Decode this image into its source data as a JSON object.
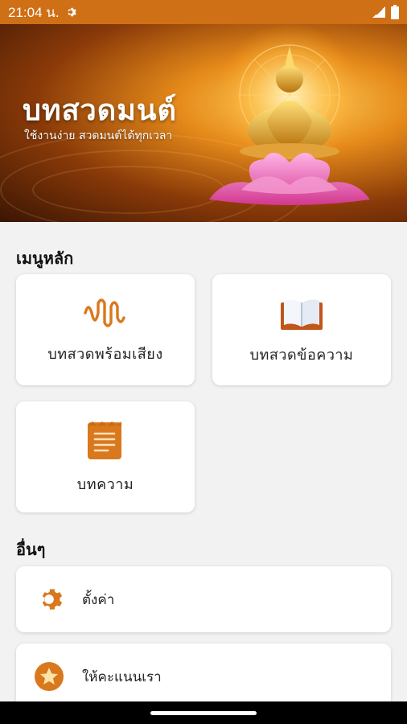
{
  "status_bar": {
    "time": "21:04 น.",
    "background": "#cf6f16"
  },
  "banner": {
    "title": "บทสวดมนต์",
    "subtitle": "ใช้งานง่าย สวดมนต์ได้ทุกเวลา"
  },
  "main_menu": {
    "title": "เมนูหลัก",
    "items": [
      {
        "label": "บทสวดพร้อมเสียง",
        "icon": "audio-wave-icon"
      },
      {
        "label": "บทสวดข้อความ",
        "icon": "open-book-icon"
      },
      {
        "label": "บทความ",
        "icon": "notepad-icon"
      }
    ]
  },
  "other": {
    "title": "อื่นๆ",
    "items": [
      {
        "label": "ตั้งค่า",
        "icon": "gear-icon"
      },
      {
        "label": "ให้คะแนนเรา",
        "icon": "star-icon"
      }
    ]
  },
  "colors": {
    "accent": "#d9781c",
    "background": "#f2f2f2"
  }
}
